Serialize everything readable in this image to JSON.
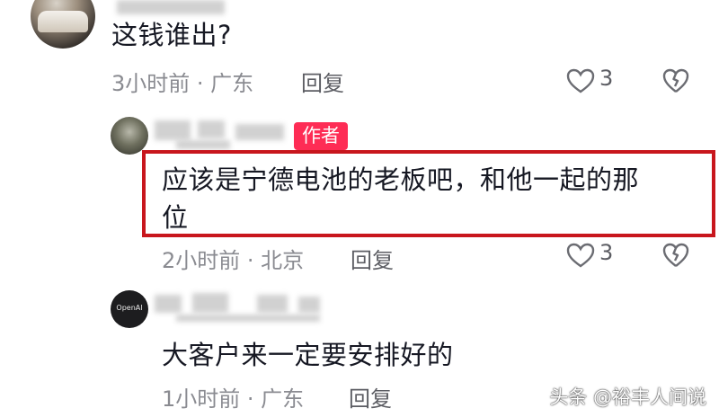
{
  "comments": [
    {
      "text": "这钱谁出?",
      "meta": "3小时前 · 广东",
      "reply_label": "回复",
      "likes": "3"
    },
    {
      "badge": "作者",
      "text_line1": "应该是宁德电池的老板吧，和他一起的那",
      "text_line2": "位",
      "meta": "2小时前 · 北京",
      "reply_label": "回复",
      "likes": "3"
    },
    {
      "avatar_text": "OpenAI",
      "text": "大客户来一定要安排好的",
      "meta": "1小时前 · 广东",
      "reply_label": "回复"
    }
  ],
  "watermark": "头条 @裕丰人间说",
  "colors": {
    "highlight_border": "#c8161d",
    "author_badge": "#fe2c55",
    "meta_text": "#8a8b91"
  },
  "icons": [
    "heart-outline-icon",
    "heart-broken-icon"
  ]
}
